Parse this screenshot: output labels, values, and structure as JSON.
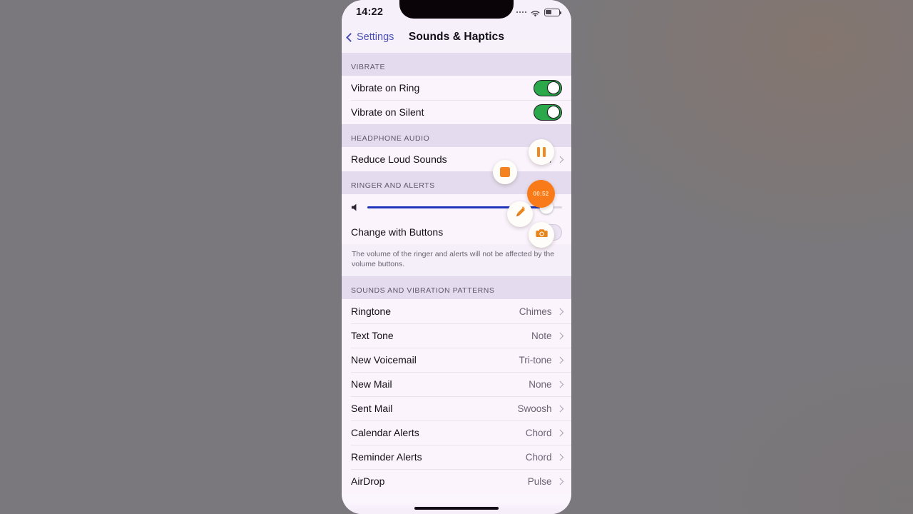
{
  "statusbar": {
    "time": "14:22",
    "signal_icon": "signal-dots-icon",
    "wifi_icon": "wifi-icon",
    "battery_icon": "battery-icon",
    "battery_level_pct": 45
  },
  "navbar": {
    "back_label": "Settings",
    "back_icon": "chevron-left-icon",
    "title": "Sounds & Haptics"
  },
  "sections": {
    "vibrate": {
      "header": "VIBRATE",
      "rows": [
        {
          "label": "Vibrate on Ring",
          "toggle": "on"
        },
        {
          "label": "Vibrate on Silent",
          "toggle": "on"
        }
      ]
    },
    "headphone_audio": {
      "header": "HEADPHONE AUDIO",
      "rows": [
        {
          "label": "Reduce Loud Sounds",
          "value": "Off"
        }
      ]
    },
    "ringer_and_alerts": {
      "header": "RINGER AND ALERTS",
      "slider": {
        "icon": "speaker-icon",
        "value_pct": 92
      },
      "change_with_buttons": {
        "label": "Change with Buttons",
        "toggle": "off"
      },
      "footnote": "The volume of the ringer and alerts will not be affected by the volume buttons."
    },
    "sounds_and_vibration_patterns": {
      "header": "SOUNDS AND VIBRATION PATTERNS",
      "rows": [
        {
          "label": "Ringtone",
          "value": "Chimes"
        },
        {
          "label": "Text Tone",
          "value": "Note"
        },
        {
          "label": "New Voicemail",
          "value": "Tri-tone"
        },
        {
          "label": "New Mail",
          "value": "None"
        },
        {
          "label": "Sent Mail",
          "value": "Swoosh"
        },
        {
          "label": "Calendar Alerts",
          "value": "Chord"
        },
        {
          "label": "Reminder Alerts",
          "value": "Chord"
        },
        {
          "label": "AirDrop",
          "value": "Pulse"
        }
      ]
    }
  },
  "recorder_overlay": {
    "pause_icon": "pause-icon",
    "stop_icon": "stop-icon",
    "timer": "00:52",
    "brush_icon": "brush-icon",
    "camera_icon": "camera-icon",
    "accent_color": "#f97a19"
  },
  "colors": {
    "toggle_on": "#2ba84a",
    "slider_fill": "#1f33bb",
    "link": "#4a4fb5",
    "group_bg": "#e4dcee",
    "cell_bg": "#fbf4fd"
  }
}
